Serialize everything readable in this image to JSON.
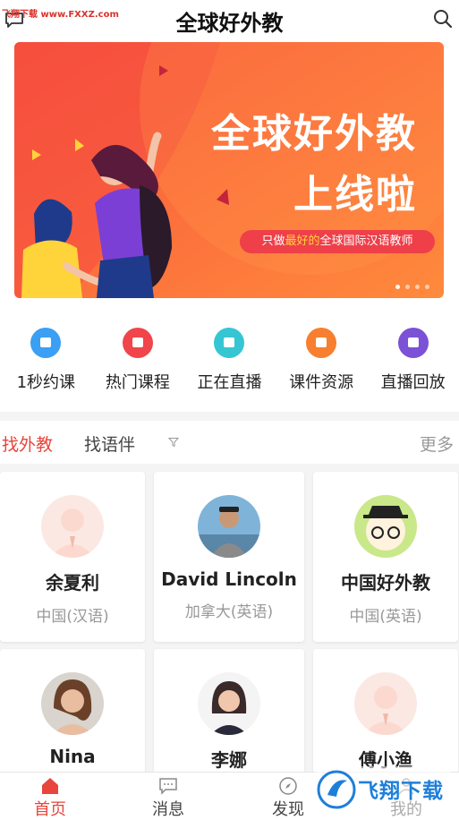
{
  "header": {
    "title": "全球好外教",
    "watermark": "飞翔下载 www.FXXZ.com"
  },
  "banner": {
    "title_line1": "全球好外教",
    "title_line2": "上线啦",
    "pill_before": "只做",
    "pill_highlight": "最好的",
    "pill_after": "全球国际汉语教师",
    "dots": 4,
    "active_dot": 0,
    "colors": {
      "bg_start": "#f9533c",
      "bg_end": "#ff8a3c",
      "accent": "#ffd43b"
    }
  },
  "quick_menu": [
    {
      "label": "1秒约课",
      "icon": "calendar-icon",
      "color": "#3b9ff3"
    },
    {
      "label": "热门课程",
      "icon": "course-icon",
      "color": "#f0454a"
    },
    {
      "label": "正在直播",
      "icon": "live-icon",
      "color": "#36c6d3"
    },
    {
      "label": "课件资源",
      "icon": "resource-icon",
      "color": "#f77f2f"
    },
    {
      "label": "直播回放",
      "icon": "replay-icon",
      "color": "#7b51d6"
    }
  ],
  "tabs": {
    "foreign_teacher": "找外教",
    "language_partner": "找语伴",
    "more": "更多"
  },
  "teachers": [
    {
      "name": "余夏利",
      "subtitle": "中国(汉语)",
      "avatar": "default-avatar"
    },
    {
      "name": "David Lincoln",
      "subtitle": "加拿大(英语)",
      "avatar": "photo-avatar"
    },
    {
      "name": "中国好外教",
      "subtitle": "中国(英语)",
      "avatar": "cartoon-avatar"
    },
    {
      "name": "Nina",
      "subtitle": "",
      "avatar": "photo-avatar"
    },
    {
      "name": "李娜",
      "subtitle": "",
      "avatar": "photo-avatar"
    },
    {
      "name": "傅小渔",
      "subtitle": "",
      "avatar": "default-avatar"
    }
  ],
  "bottom_nav": {
    "home": "首页",
    "messages": "消息",
    "discover": "发现",
    "mine": "我的"
  },
  "watermark_br": "飞翔下载",
  "colors": {
    "accent": "#e8453c",
    "muted": "#999999"
  }
}
